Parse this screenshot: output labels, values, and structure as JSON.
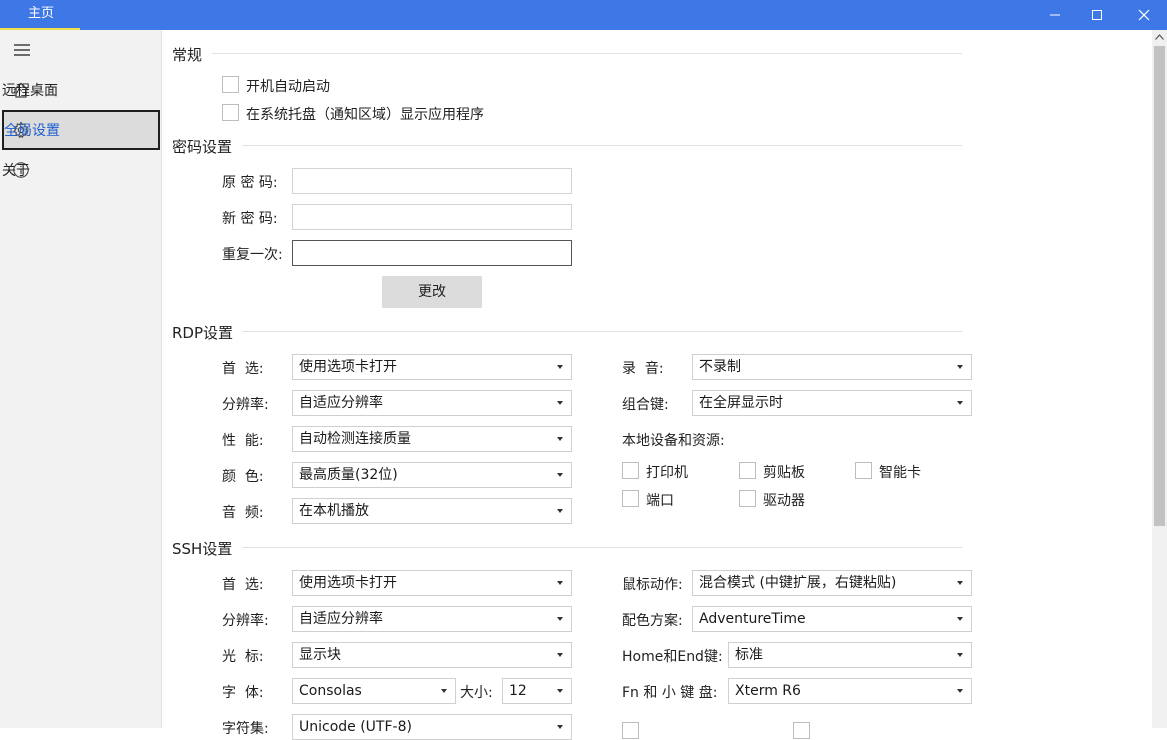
{
  "titlebar": {
    "tab": "主页"
  },
  "sidebar": {
    "items": [
      {
        "label": "远程桌面",
        "icon": "home-icon"
      },
      {
        "label": "全局设置",
        "icon": "gear-icon",
        "active": true
      },
      {
        "label": "关于",
        "icon": "info-icon"
      }
    ]
  },
  "general": {
    "title": "常规",
    "autostart": "开机自动启动",
    "tray": "在系统托盘（通知区域）显示应用程序"
  },
  "password": {
    "title": "密码设置",
    "old_label": "原 密 码:",
    "new_label": "新 密 码:",
    "repeat_label": "重复一次:",
    "change_button": "更改"
  },
  "rdp": {
    "title": "RDP设置",
    "preference_label": "首  选:",
    "preference_value": "使用选项卡打开",
    "resolution_label": "分辨率:",
    "resolution_value": "自适应分辨率",
    "performance_label": "性  能:",
    "performance_value": "自动检测连接质量",
    "color_label": "颜  色:",
    "color_value": "最高质量(32位)",
    "audio_label": "音  频:",
    "audio_value": "在本机播放",
    "record_label": "录  音:",
    "record_value": "不录制",
    "combo_label": "组合键:",
    "combo_value": "在全屏显示时",
    "local_label": "本地设备和资源:",
    "printer": "打印机",
    "clipboard": "剪贴板",
    "smartcard": "智能卡",
    "port": "端口",
    "drive": "驱动器"
  },
  "ssh": {
    "title": "SSH设置",
    "preference_label": "首  选:",
    "preference_value": "使用选项卡打开",
    "resolution_label": "分辨率:",
    "resolution_value": "自适应分辨率",
    "cursor_label": "光  标:",
    "cursor_value": "显示块",
    "font_label": "字  体:",
    "font_value": "Consolas",
    "size_label": "大小:",
    "size_value": "12",
    "charset_label": "字符集:",
    "charset_value": "Unicode (UTF-8)",
    "mouse_label": "鼠标动作:",
    "mouse_value": "混合模式 (中键扩展，右键粘贴)",
    "scheme_label": "配色方案:",
    "scheme_value": "AdventureTime",
    "homeend_label": "Home和End键:",
    "homeend_value": "标准",
    "fnkeypad_label": "Fn 和 小 键 盘:",
    "fnkeypad_value": "Xterm R6"
  }
}
